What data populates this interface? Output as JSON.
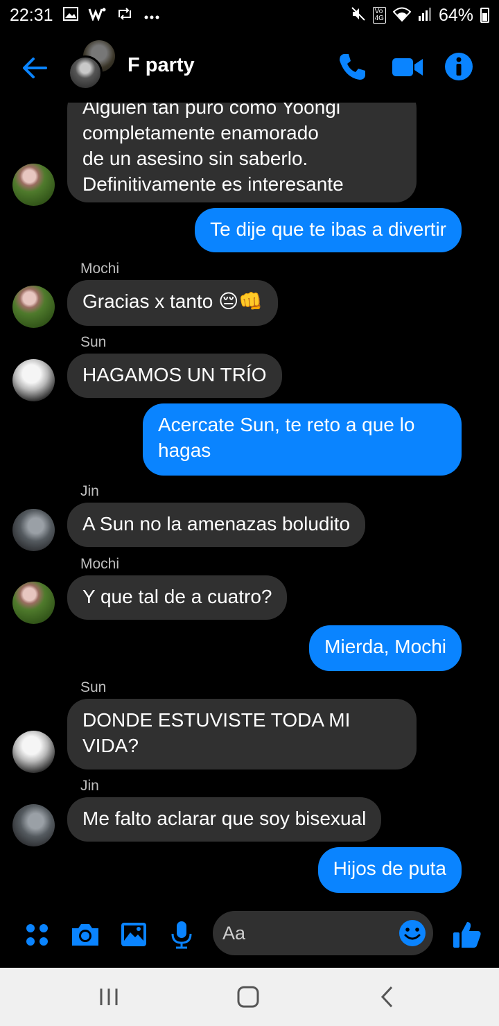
{
  "status_bar": {
    "time": "22:31",
    "battery": "64%",
    "icons_left": [
      "gallery-icon",
      "w-icon",
      "retweet-icon",
      "more-icon"
    ],
    "icons_right": [
      "mute-icon",
      "volte-icon",
      "wifi-icon",
      "signal-icon",
      "battery-icon"
    ]
  },
  "header": {
    "title": "F party",
    "accent_color": "#0a84ff"
  },
  "messages": [
    {
      "type": "in",
      "sender": "",
      "lines": [
        "Alguien tan puro como Yoongi",
        "completamente enamorado",
        "de un asesino sin saberlo.",
        "Definitivamente es interesante"
      ]
    },
    {
      "type": "out",
      "text": "Te dije que te ibas a divertir"
    },
    {
      "type": "in",
      "sender": "Mochi",
      "text": "Gracias x tanto",
      "emoji": "😔👊"
    },
    {
      "type": "in",
      "sender": "Sun",
      "text": "HAGAMOS UN TRÍO"
    },
    {
      "type": "out",
      "lines": [
        "Acercate Sun, te reto a que lo",
        "hagas"
      ]
    },
    {
      "type": "in",
      "sender": "Jin",
      "text": "A Sun no la amenazas boludito"
    },
    {
      "type": "in",
      "sender": "Mochi",
      "text": "Y que tal de a cuatro?"
    },
    {
      "type": "out",
      "text": "Mierda, Mochi"
    },
    {
      "type": "in",
      "sender": "Sun",
      "lines": [
        "DONDE ESTUVISTE TODA MI",
        "VIDA?"
      ]
    },
    {
      "type": "in",
      "sender": "Jin",
      "text": "Me falto aclarar que soy bisexual"
    },
    {
      "type": "out",
      "text": "Hijos de puta"
    }
  ],
  "composer": {
    "placeholder": "Aa"
  },
  "colors": {
    "outgoing_bubble": "#0a84ff",
    "incoming_bubble": "#303030",
    "background": "#000000"
  }
}
